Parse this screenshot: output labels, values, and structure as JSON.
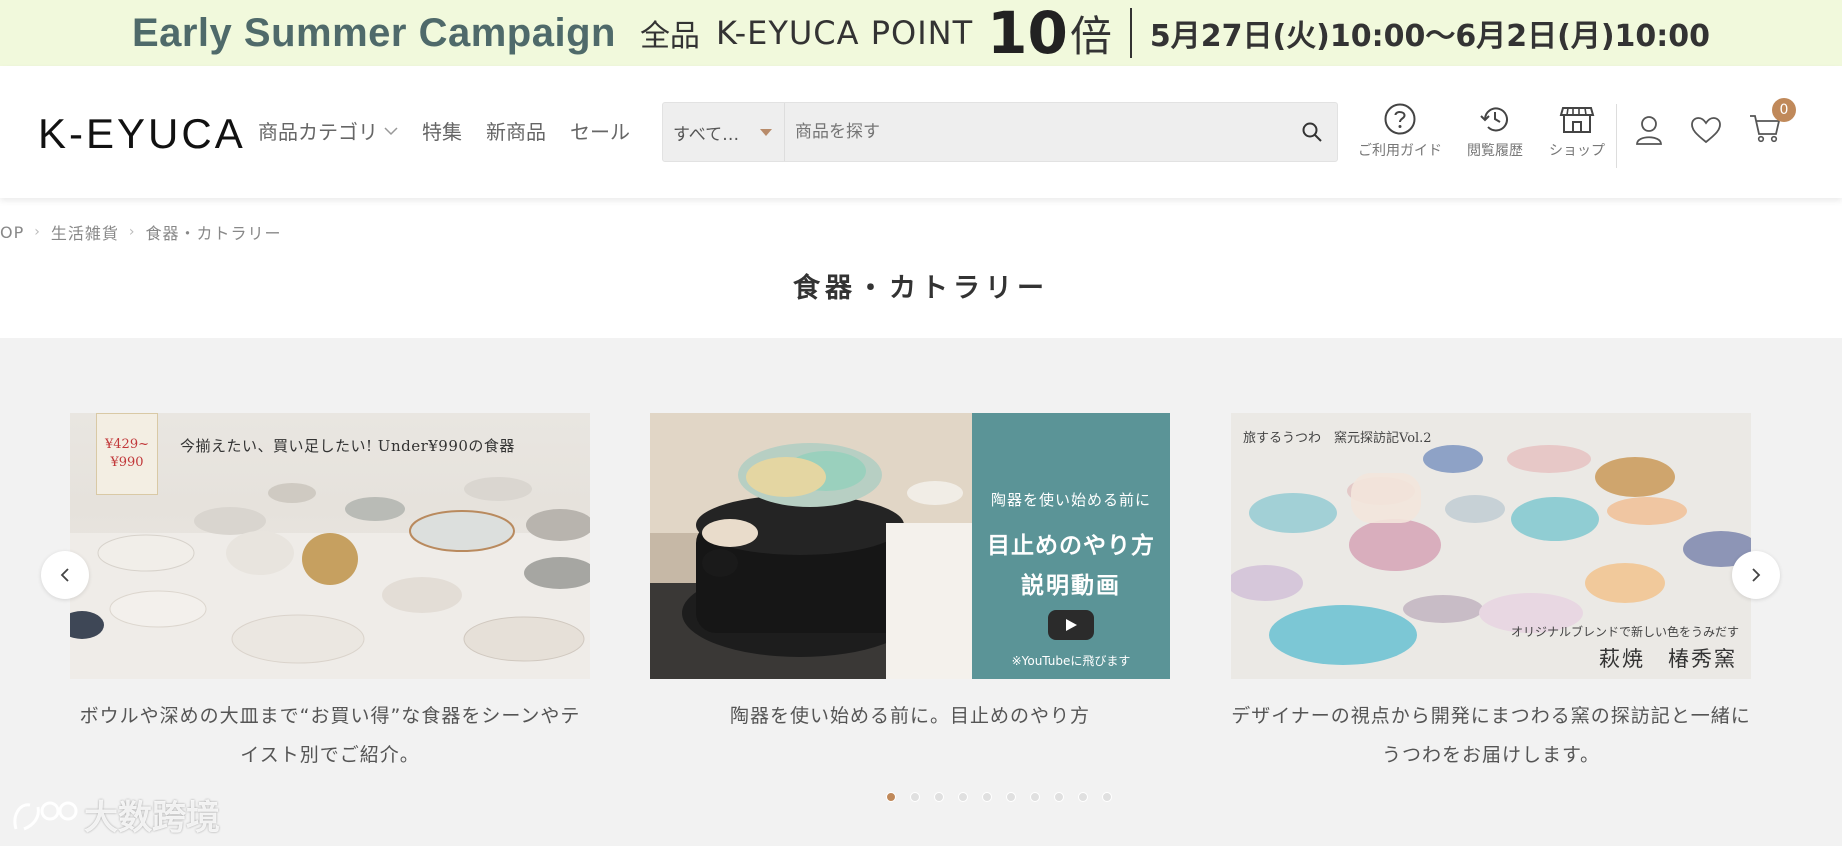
{
  "banner": {
    "campaign": "Early Summer Campaign",
    "all": "全品",
    "point": "K-EYUCA POINT",
    "multiplier": "10",
    "bai": "倍",
    "dates": "5月27日(火)10:00〜6月2日(月)10:00"
  },
  "header": {
    "logo": "K-EYUCA",
    "nav": {
      "category": "商品カテゴリ",
      "feature": "特集",
      "new": "新商品",
      "sale": "セール"
    },
    "search": {
      "select_value": "すべて…",
      "placeholder": "商品を探す"
    },
    "icons": {
      "guide": "ご利用ガイド",
      "history": "閲覧履歴",
      "shop": "ショップ"
    },
    "cart_count": "0"
  },
  "breadcrumb": {
    "top": "OP",
    "level1": "生活雑貨",
    "level2": "食器・カトラリー"
  },
  "page_title": "食器・カトラリー",
  "carousel": {
    "cards": [
      {
        "tag_price": "¥429~\n¥990",
        "headline": "今揃えたい、買い足したい! Under¥990の食器",
        "caption": "ボウルや深めの大皿まで“お買い得”な食器をシーンやテイスト別でご紹介。"
      },
      {
        "panel_top": "陶器を使い始める前に",
        "panel_main1": "目止めのやり方",
        "panel_main2": "説明動画",
        "panel_note": "※YouTubeに飛びます",
        "caption": "陶器を使い始める前に。目止めのやり方"
      },
      {
        "headline": "旅するうつわ　窯元探訪記Vol.2",
        "subline": "オリジナルブレンドで新しい色をうみだす",
        "kiln": "萩焼　椿秀窯",
        "caption": "デザイナーの視点から開発にまつわる窯の探訪記と一緒にうつわをお届けします。"
      }
    ],
    "active_dot": 1,
    "dot_count": 10
  },
  "watermark": "大数跨境",
  "colors": {
    "banner_bg": "#f1f9dc",
    "accent": "#c0895a",
    "teal_panel": "#5b9497"
  }
}
